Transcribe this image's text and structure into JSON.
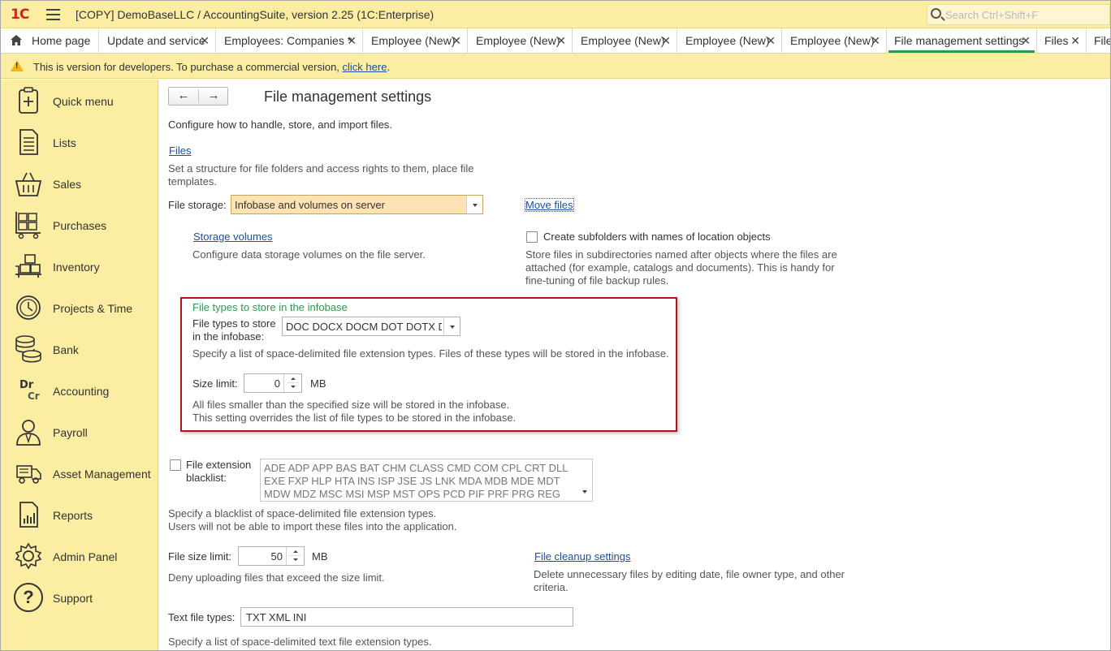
{
  "app": {
    "title": "[COPY] DemoBaseLLC / AccountingSuite, version 2.25  (1C:Enterprise)",
    "logo_text": "1C",
    "search_placeholder": "Search Ctrl+Shift+F"
  },
  "tabs": [
    {
      "label": "Home page"
    },
    {
      "label": "Update and service"
    },
    {
      "label": "Employees: Companies *"
    },
    {
      "label": "Employee (New)"
    },
    {
      "label": "Employee (New)"
    },
    {
      "label": "Employee (New)"
    },
    {
      "label": "Employee (New)"
    },
    {
      "label": "Employee (New)"
    },
    {
      "label": "File management settings"
    },
    {
      "label": "Files"
    },
    {
      "label": "File"
    }
  ],
  "tab_close": "✕",
  "banner": {
    "text": "This is version for developers. To purchase a commercial version, ",
    "link": "click here",
    "end": "."
  },
  "sidebar": {
    "items": [
      {
        "label": "Quick menu",
        "icon": "quick-menu-icon"
      },
      {
        "label": "Lists",
        "icon": "lists-icon"
      },
      {
        "label": "Sales",
        "icon": "basket-icon"
      },
      {
        "label": "Purchases",
        "icon": "cart-icon"
      },
      {
        "label": "Inventory",
        "icon": "boxes-icon"
      },
      {
        "label": "Projects & Time",
        "icon": "clock-icon"
      },
      {
        "label": "Bank",
        "icon": "coins-icon"
      },
      {
        "label": "Accounting",
        "icon": "dr-cr-icon"
      },
      {
        "label": "Payroll",
        "icon": "person-icon"
      },
      {
        "label": "Asset Management",
        "icon": "truck-icon"
      },
      {
        "label": "Reports",
        "icon": "report-icon"
      },
      {
        "label": "Admin Panel",
        "icon": "gear-icon"
      },
      {
        "label": "Support",
        "icon": "question-icon"
      }
    ],
    "dr": "Dr",
    "cr": "Cr",
    "support_glyph": "?"
  },
  "page": {
    "back": "←",
    "forward": "→",
    "title": "File management settings",
    "intro": "Configure how to handle, store, and import files.",
    "files_link": "Files",
    "files_desc_1": "Set a structure for file folders and access rights to them, place file",
    "files_desc_2": "templates.",
    "storage_label": "File storage:",
    "storage_value": "Infobase and volumes on server",
    "move_files": "Move files",
    "storage_volumes_link": "Storage volumes",
    "storage_volumes_desc": "Configure data storage volumes on the file server.",
    "subfolders_label": "Create subfolders with names of location objects",
    "subfolders_desc_1": "Store files in subdirectories named after objects where the files are",
    "subfolders_desc_2": "attached (for example, catalogs and documents). This is handy for",
    "subfolders_desc_3": "fine-tuning of file backup rules.",
    "group_title": "File types to store in the infobase",
    "types_label_1": "File types to store",
    "types_label_2": "in the infobase:",
    "types_value": "DOC DOCX DOCM DOT DOTX D",
    "types_desc": "Specify a list of space-delimited file extension types. Files of these types will be stored in the infobase.",
    "size_label": "Size limit:",
    "size_value": "0",
    "size_unit": "MB",
    "size_desc_1": "All files smaller than the specified size will be stored in the infobase.",
    "size_desc_2": "This setting overrides the list of file types to be stored in the infobase.",
    "blacklist_label_1": "File extension",
    "blacklist_label_2": "blacklist:",
    "blacklist_line_1": " ADE ADP APP BAS BAT CHM CLASS CMD COM CPL CRT DLL",
    "blacklist_line_2": "EXE FXP HLP HTA INS ISP JSE JS LNK MDA MDB MDE MDT",
    "blacklist_line_3": "MDW MDZ MSC MSI MSP MST OPS PCD PIF PRF PRG REG",
    "blacklist_desc_1": "Specify a blacklist of space-delimited file extension types.",
    "blacklist_desc_2": "Users will not be able to import these files into the application.",
    "file_size_label": "File size limit:",
    "file_size_value": "50",
    "file_size_unit": "MB",
    "file_size_desc": "Deny uploading files that exceed the size limit.",
    "cleanup_link": "File cleanup settings",
    "cleanup_desc_1": "Delete unnecessary files by editing date, file owner type, and other",
    "cleanup_desc_2": "criteria.",
    "text_types_label": "Text file types:",
    "text_types_value": "TXT XML INI",
    "text_types_desc": "Specify a list of space-delimited text file extension types."
  },
  "colors": {
    "accent_green": "#2d9a4a",
    "highlight_red": "#b3131b",
    "panel_yellow": "#fbeda1"
  }
}
